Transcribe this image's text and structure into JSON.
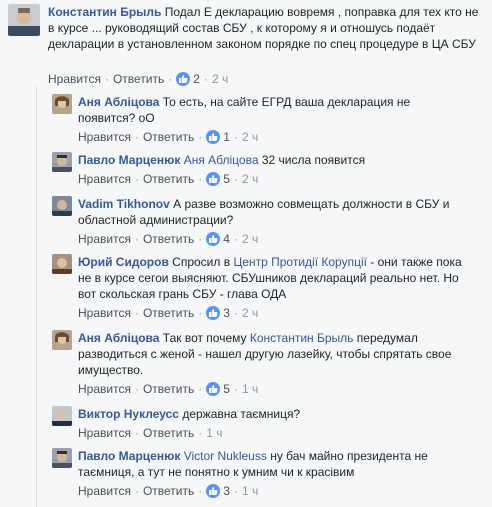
{
  "labels": {
    "like": "Нравится",
    "reply": "Ответить"
  },
  "comments": [
    {
      "author": "Константин Брыль",
      "text": "Подал Е декларацию вовремя , поправка для тех кто не в курсе ... руководящий состав СБУ , к которому я и отношусь подаёт декларации в установленном законом порядке по спец процедуре в ЦА СБУ",
      "likes": "2",
      "time": "2 ч"
    },
    {
      "author": "Аня Абліцова",
      "text": "То есть, на сайте ЕГРД ваша декларация не появится? оО",
      "likes": "1",
      "time": "2 ч"
    },
    {
      "author": "Павло Марценюк",
      "mention": "Аня Абліцова",
      "text": "32 числа появится",
      "likes": "5",
      "time": "2 ч"
    },
    {
      "author": "Vadim Tikhonov",
      "text": "А разве возможно совмещать должности в СБУ и областной администрации?",
      "likes": "4",
      "time": "2 ч"
    },
    {
      "author": "Юрий Сидоров",
      "text_before": "Спросил в",
      "mention": "Центр Протидії Корупції",
      "text_after": "- они также пока не в курсе сегои выясняют. СБУшников деклараций реально нет. Но вот скольская грань СБУ - глава ОДА",
      "likes": "3",
      "time": "2 ч"
    },
    {
      "author": "Аня Абліцова",
      "text_before": "Так вот почему",
      "mention": "Константин Брыль",
      "text_after": "передумал разводиться с женой - нашел другую лазейку, чтобы спрятать свое имущество.",
      "likes": "5",
      "time": "1 ч"
    },
    {
      "author": "Виктор Нуклеусс",
      "text": "державна таємниця?",
      "time": "1 ч"
    },
    {
      "author": "Павло Марценюк",
      "mention": "Victor Nukleuss",
      "text": "ну бач майно президента не таємниця, а тут не понятно к умним чи к красівим",
      "likes": "3",
      "time": "1 ч"
    }
  ],
  "colors": {
    "link": "#365899",
    "like": "#5890ff",
    "meta": "#90949c",
    "background": "#f6f7f9"
  }
}
